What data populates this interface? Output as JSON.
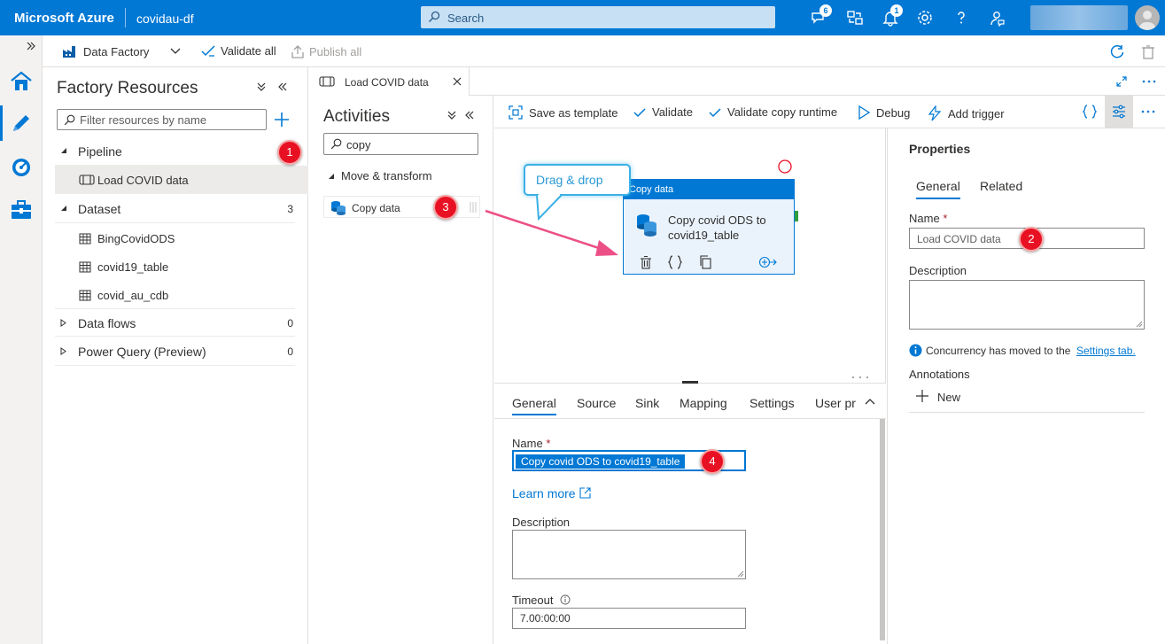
{
  "topbar": {
    "brand": "Microsoft Azure",
    "resource": "covidau-df",
    "search_placeholder": "Search",
    "notifications_count_a": "6",
    "notifications_count_b": "1"
  },
  "commandbar": {
    "factory_label": "Data Factory",
    "validate_all": "Validate all",
    "publish_all": "Publish all"
  },
  "factory_resources": {
    "title": "Factory Resources",
    "filter_placeholder": "Filter resources by name",
    "pipeline_label": "Pipeline",
    "pipelines": [
      "Load COVID data"
    ],
    "dataset_label": "Dataset",
    "dataset_count": "3",
    "datasets": [
      "BingCovidODS",
      "covid19_table",
      "covid_au_cdb"
    ],
    "dataflows_label": "Data flows",
    "dataflows_count": "0",
    "powerquery_label": "Power Query (Preview)",
    "powerquery_count": "0"
  },
  "tab": {
    "label": "Load COVID data"
  },
  "activities": {
    "title": "Activities",
    "search_value": "copy",
    "group": "Move & transform",
    "item": "Copy data"
  },
  "pipeline_toolbar": {
    "save_template": "Save as template",
    "validate": "Validate",
    "validate_copy": "Validate copy runtime",
    "debug": "Debug",
    "add_trigger": "Add trigger"
  },
  "canvas": {
    "callout": "Drag & drop",
    "node_title": "Copy data",
    "node_name": "Copy covid ODS to covid19_table"
  },
  "bottom": {
    "tabs": [
      "General",
      "Source",
      "Sink",
      "Mapping",
      "Settings",
      "User pr"
    ],
    "name_label": "Name",
    "name_value": "Copy covid ODS to covid19_table",
    "learn_more": "Learn more",
    "description_label": "Description",
    "timeout_label": "Timeout",
    "timeout_value": "7.00:00:00"
  },
  "properties": {
    "title": "Properties",
    "tabs": [
      "General",
      "Related"
    ],
    "name_label": "Name",
    "name_value": "Load COVID data",
    "description_label": "Description",
    "info_text": "Concurrency has moved to the",
    "info_link": "Settings tab.",
    "annotations_label": "Annotations",
    "new_label": "New"
  },
  "annotations": {
    "badge_1": "1",
    "badge_2": "2",
    "badge_3": "3",
    "badge_4": "4"
  },
  "colors": {
    "azure_blue": "#0078d4",
    "badge_red": "#e81123",
    "arrow_pink": "#ec4f86",
    "callout_blue": "#3ab0e6"
  }
}
